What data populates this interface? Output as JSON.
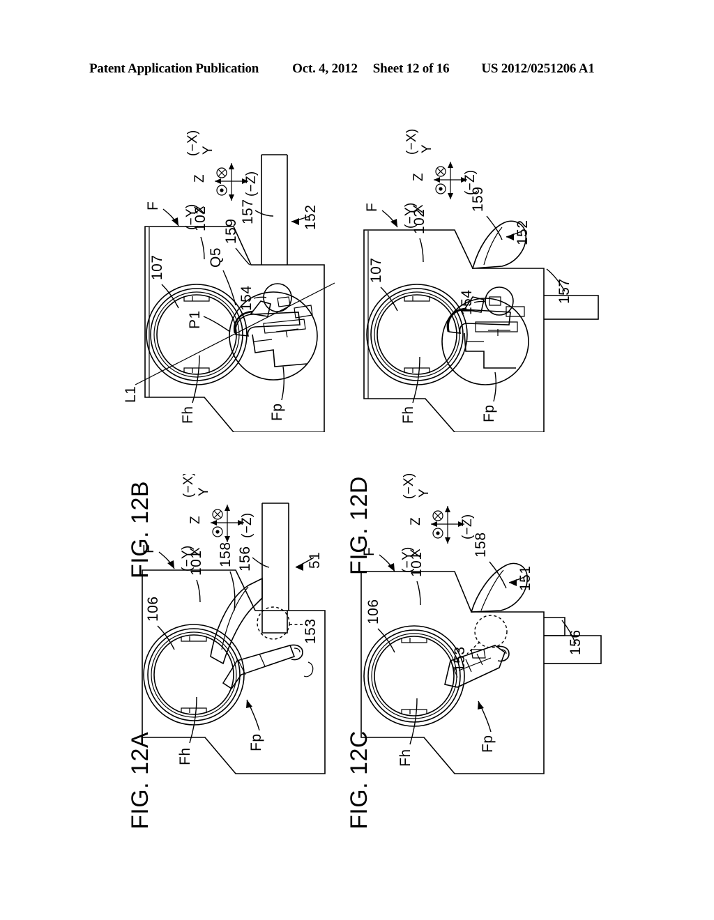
{
  "header": {
    "publication": "Patent Application Publication",
    "date": "Oct. 4, 2012",
    "sheet": "Sheet 12 of 16",
    "patent_number": "US 2012/0251206 A1"
  },
  "figures": [
    {
      "id": "fig-12a",
      "caption": "FIG. 12A",
      "axis": {
        "x": "X",
        "z": "Z",
        "neg_x": "(−X)",
        "y": "Y",
        "neg_y": "(−Y)",
        "neg_z": "(−Z)",
        "into_page_icon": "x-into-page",
        "out_of_page_icon": "dot-out-of-page"
      },
      "arrow_label": "F",
      "reference_numerals": [
        "101",
        "106",
        "156",
        "158",
        "51",
        "153"
      ],
      "part_labels": [
        "Fh",
        "Fp"
      ]
    },
    {
      "id": "fig-12b",
      "caption": "FIG. 12B",
      "axis": {
        "x": "X",
        "z": "Z",
        "neg_x": "(−X)",
        "y": "Y",
        "neg_y": "(−Y)",
        "neg_z": "(−Z)",
        "into_page_icon": "x-into-page",
        "out_of_page_icon": "dot-out-of-page"
      },
      "arrow_label": "F",
      "reference_numerals": [
        "102",
        "107",
        "154",
        "157",
        "159",
        "152"
      ],
      "part_labels": [
        "Fh",
        "Fp",
        "P1",
        "Q5",
        "L1"
      ]
    },
    {
      "id": "fig-12c",
      "caption": "FIG. 12C",
      "axis": {
        "x": "X",
        "z": "Z",
        "neg_x": "(−X)",
        "y": "Y",
        "neg_y": "(−Y)",
        "neg_z": "(−Z)",
        "into_page_icon": "x-into-page",
        "out_of_page_icon": "dot-out-of-page"
      },
      "arrow_label": "F",
      "reference_numerals": [
        "101",
        "106",
        "151",
        "156",
        "158",
        "153"
      ],
      "part_labels": [
        "Fh",
        "Fp"
      ]
    },
    {
      "id": "fig-12d",
      "caption": "FIG. 12D",
      "axis": {
        "x": "X",
        "z": "Z",
        "neg_x": "(−X)",
        "y": "Y",
        "neg_y": "(−Y)",
        "neg_z": "(−Z)",
        "into_page_icon": "x-into-page",
        "out_of_page_icon": "dot-out-of-page"
      },
      "arrow_label": "F",
      "reference_numerals": [
        "102",
        "107",
        "154",
        "157",
        "159",
        "152"
      ],
      "part_labels": [
        "Fh",
        "Fp"
      ]
    }
  ],
  "fig12a": {
    "caption": "FIG. 12A",
    "arrow_label": "F",
    "n101": "101",
    "n106": "106",
    "n156": "156",
    "n158": "158",
    "n51": "51",
    "n153": "153",
    "fh": "Fh",
    "fp": "Fp",
    "ax_x": "X",
    "ax_z": "Z",
    "ax_negx": "(−X)",
    "ax_y": "Y",
    "ax_negy": "(−Y)",
    "ax_negz": "(−Z)"
  },
  "fig12b": {
    "caption": "FIG. 12B",
    "arrow_label": "F",
    "n102": "102",
    "n107": "107",
    "n154": "154",
    "n157": "157",
    "n159": "159",
    "n152": "152",
    "fh": "Fh",
    "fp": "Fp",
    "p1": "P1",
    "q5": "Q5",
    "l1": "L1",
    "ax_x": "X",
    "ax_z": "Z",
    "ax_negx": "(−X)",
    "ax_y": "Y",
    "ax_negy": "(−Y)",
    "ax_negz": "(−Z)"
  },
  "fig12c": {
    "caption": "FIG. 12C",
    "arrow_label": "F",
    "n101": "101",
    "n106": "106",
    "n151": "151",
    "n156": "156",
    "n158": "158",
    "n153": "153",
    "fh": "Fh",
    "fp": "Fp",
    "ax_x": "X",
    "ax_z": "Z",
    "ax_negx": "(−X)",
    "ax_y": "Y",
    "ax_negy": "(−Y)",
    "ax_negz": "(−Z)"
  },
  "fig12d": {
    "caption": "FIG. 12D",
    "arrow_label": "F",
    "n102": "102",
    "n107": "107",
    "n154": "154",
    "n157": "157",
    "n159": "159",
    "n152": "152",
    "fh": "Fh",
    "fp": "Fp",
    "ax_x": "X",
    "ax_z": "Z",
    "ax_negx": "(−X)",
    "ax_y": "Y",
    "ax_negy": "(−Y)",
    "ax_negz": "(−Z)"
  }
}
